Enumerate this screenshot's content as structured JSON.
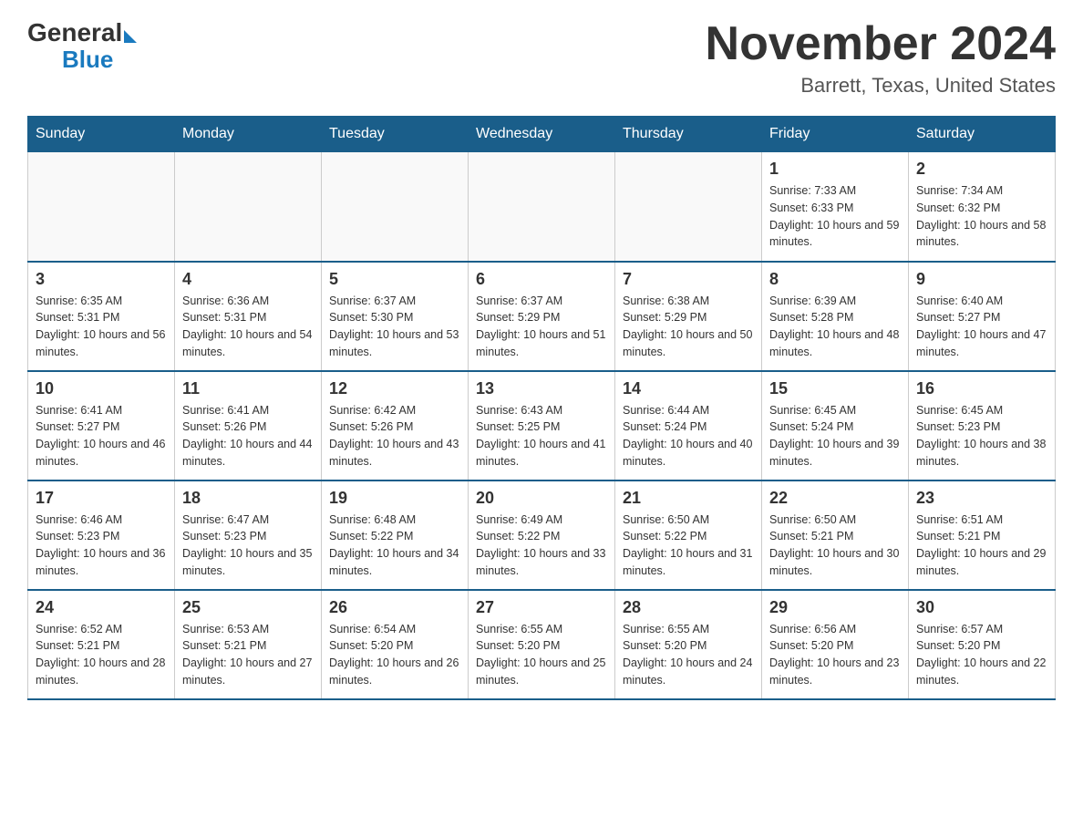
{
  "header": {
    "logo_general": "General",
    "logo_blue": "Blue",
    "month_title": "November 2024",
    "location": "Barrett, Texas, United States"
  },
  "weekdays": [
    "Sunday",
    "Monday",
    "Tuesday",
    "Wednesday",
    "Thursday",
    "Friday",
    "Saturday"
  ],
  "weeks": [
    [
      {
        "day": "",
        "sunrise": "",
        "sunset": "",
        "daylight": ""
      },
      {
        "day": "",
        "sunrise": "",
        "sunset": "",
        "daylight": ""
      },
      {
        "day": "",
        "sunrise": "",
        "sunset": "",
        "daylight": ""
      },
      {
        "day": "",
        "sunrise": "",
        "sunset": "",
        "daylight": ""
      },
      {
        "day": "",
        "sunrise": "",
        "sunset": "",
        "daylight": ""
      },
      {
        "day": "1",
        "sunrise": "Sunrise: 7:33 AM",
        "sunset": "Sunset: 6:33 PM",
        "daylight": "Daylight: 10 hours and 59 minutes."
      },
      {
        "day": "2",
        "sunrise": "Sunrise: 7:34 AM",
        "sunset": "Sunset: 6:32 PM",
        "daylight": "Daylight: 10 hours and 58 minutes."
      }
    ],
    [
      {
        "day": "3",
        "sunrise": "Sunrise: 6:35 AM",
        "sunset": "Sunset: 5:31 PM",
        "daylight": "Daylight: 10 hours and 56 minutes."
      },
      {
        "day": "4",
        "sunrise": "Sunrise: 6:36 AM",
        "sunset": "Sunset: 5:31 PM",
        "daylight": "Daylight: 10 hours and 54 minutes."
      },
      {
        "day": "5",
        "sunrise": "Sunrise: 6:37 AM",
        "sunset": "Sunset: 5:30 PM",
        "daylight": "Daylight: 10 hours and 53 minutes."
      },
      {
        "day": "6",
        "sunrise": "Sunrise: 6:37 AM",
        "sunset": "Sunset: 5:29 PM",
        "daylight": "Daylight: 10 hours and 51 minutes."
      },
      {
        "day": "7",
        "sunrise": "Sunrise: 6:38 AM",
        "sunset": "Sunset: 5:29 PM",
        "daylight": "Daylight: 10 hours and 50 minutes."
      },
      {
        "day": "8",
        "sunrise": "Sunrise: 6:39 AM",
        "sunset": "Sunset: 5:28 PM",
        "daylight": "Daylight: 10 hours and 48 minutes."
      },
      {
        "day": "9",
        "sunrise": "Sunrise: 6:40 AM",
        "sunset": "Sunset: 5:27 PM",
        "daylight": "Daylight: 10 hours and 47 minutes."
      }
    ],
    [
      {
        "day": "10",
        "sunrise": "Sunrise: 6:41 AM",
        "sunset": "Sunset: 5:27 PM",
        "daylight": "Daylight: 10 hours and 46 minutes."
      },
      {
        "day": "11",
        "sunrise": "Sunrise: 6:41 AM",
        "sunset": "Sunset: 5:26 PM",
        "daylight": "Daylight: 10 hours and 44 minutes."
      },
      {
        "day": "12",
        "sunrise": "Sunrise: 6:42 AM",
        "sunset": "Sunset: 5:26 PM",
        "daylight": "Daylight: 10 hours and 43 minutes."
      },
      {
        "day": "13",
        "sunrise": "Sunrise: 6:43 AM",
        "sunset": "Sunset: 5:25 PM",
        "daylight": "Daylight: 10 hours and 41 minutes."
      },
      {
        "day": "14",
        "sunrise": "Sunrise: 6:44 AM",
        "sunset": "Sunset: 5:24 PM",
        "daylight": "Daylight: 10 hours and 40 minutes."
      },
      {
        "day": "15",
        "sunrise": "Sunrise: 6:45 AM",
        "sunset": "Sunset: 5:24 PM",
        "daylight": "Daylight: 10 hours and 39 minutes."
      },
      {
        "day": "16",
        "sunrise": "Sunrise: 6:45 AM",
        "sunset": "Sunset: 5:23 PM",
        "daylight": "Daylight: 10 hours and 38 minutes."
      }
    ],
    [
      {
        "day": "17",
        "sunrise": "Sunrise: 6:46 AM",
        "sunset": "Sunset: 5:23 PM",
        "daylight": "Daylight: 10 hours and 36 minutes."
      },
      {
        "day": "18",
        "sunrise": "Sunrise: 6:47 AM",
        "sunset": "Sunset: 5:23 PM",
        "daylight": "Daylight: 10 hours and 35 minutes."
      },
      {
        "day": "19",
        "sunrise": "Sunrise: 6:48 AM",
        "sunset": "Sunset: 5:22 PM",
        "daylight": "Daylight: 10 hours and 34 minutes."
      },
      {
        "day": "20",
        "sunrise": "Sunrise: 6:49 AM",
        "sunset": "Sunset: 5:22 PM",
        "daylight": "Daylight: 10 hours and 33 minutes."
      },
      {
        "day": "21",
        "sunrise": "Sunrise: 6:50 AM",
        "sunset": "Sunset: 5:22 PM",
        "daylight": "Daylight: 10 hours and 31 minutes."
      },
      {
        "day": "22",
        "sunrise": "Sunrise: 6:50 AM",
        "sunset": "Sunset: 5:21 PM",
        "daylight": "Daylight: 10 hours and 30 minutes."
      },
      {
        "day": "23",
        "sunrise": "Sunrise: 6:51 AM",
        "sunset": "Sunset: 5:21 PM",
        "daylight": "Daylight: 10 hours and 29 minutes."
      }
    ],
    [
      {
        "day": "24",
        "sunrise": "Sunrise: 6:52 AM",
        "sunset": "Sunset: 5:21 PM",
        "daylight": "Daylight: 10 hours and 28 minutes."
      },
      {
        "day": "25",
        "sunrise": "Sunrise: 6:53 AM",
        "sunset": "Sunset: 5:21 PM",
        "daylight": "Daylight: 10 hours and 27 minutes."
      },
      {
        "day": "26",
        "sunrise": "Sunrise: 6:54 AM",
        "sunset": "Sunset: 5:20 PM",
        "daylight": "Daylight: 10 hours and 26 minutes."
      },
      {
        "day": "27",
        "sunrise": "Sunrise: 6:55 AM",
        "sunset": "Sunset: 5:20 PM",
        "daylight": "Daylight: 10 hours and 25 minutes."
      },
      {
        "day": "28",
        "sunrise": "Sunrise: 6:55 AM",
        "sunset": "Sunset: 5:20 PM",
        "daylight": "Daylight: 10 hours and 24 minutes."
      },
      {
        "day": "29",
        "sunrise": "Sunrise: 6:56 AM",
        "sunset": "Sunset: 5:20 PM",
        "daylight": "Daylight: 10 hours and 23 minutes."
      },
      {
        "day": "30",
        "sunrise": "Sunrise: 6:57 AM",
        "sunset": "Sunset: 5:20 PM",
        "daylight": "Daylight: 10 hours and 22 minutes."
      }
    ]
  ]
}
